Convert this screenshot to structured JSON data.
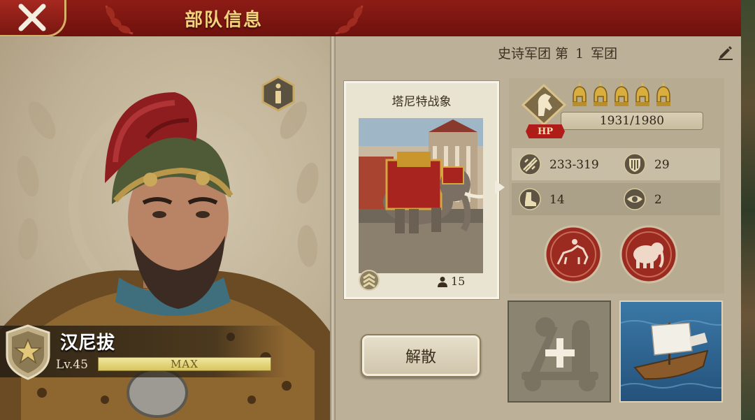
{
  "header": {
    "title": "部队信息",
    "close_icon": "close-x-icon"
  },
  "hero": {
    "name": "汉尼拔",
    "level_label": "Lv.45",
    "level_progress_text": "MAX",
    "level_progress": 1.0,
    "info_icon": "info-icon",
    "rank_icon": "star-shield-icon"
  },
  "legion": {
    "prefix": "史诗军团 第",
    "number": "1",
    "suffix": "军团",
    "edit_icon": "pencil-icon"
  },
  "unit": {
    "name": "塔尼特战象",
    "count": "15",
    "tier_icon": "chevron-rank-icon"
  },
  "stats": {
    "type_icon": "horse-head-icon",
    "hp_label": "HP",
    "hp_text": "1931/1980",
    "hp_current": 1931,
    "hp_max": 1980,
    "stars": 5,
    "attack": "233-319",
    "defense": "29",
    "speed": "14",
    "vision": "2",
    "skills": [
      "cavalry-skill-icon",
      "elephant-skill-icon"
    ]
  },
  "actions": {
    "disband_label": "解散",
    "add_slot_icon": "plus-icon",
    "ship_icon": "ship-icon"
  },
  "colors": {
    "header_red": "#8e1c16",
    "gold": "#f3d27e",
    "panel_beige": "#bcb198"
  }
}
